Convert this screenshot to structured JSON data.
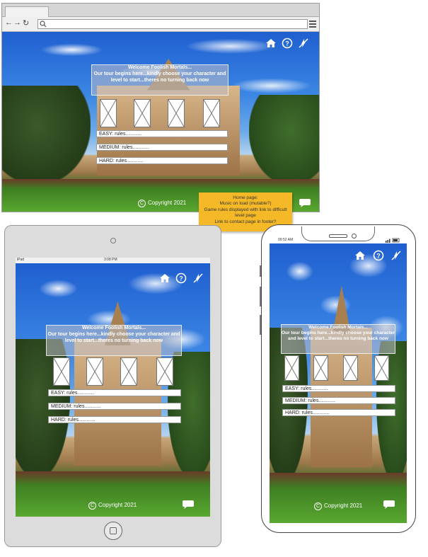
{
  "welcome": {
    "line1": "Welcome Foolish Mortals...",
    "line2": "Our tour begins here...kindly choose your character and level to start...theres no turning back now"
  },
  "rules": {
    "easy": "EASY: rules............",
    "medium": "MEDIUM: rules............",
    "hard": "HARD: rules............"
  },
  "footer": {
    "copyright": "Copyright 2021"
  },
  "note": {
    "lines": [
      "Home page:",
      "Music on load (mutable?)",
      "Game rules displayed with link to difficult level page",
      "Link to contact page in footer?"
    ]
  },
  "tablet": {
    "status_left": "iPad",
    "status_time": "3:08 PM"
  },
  "phone": {
    "status_time": "09:52 AM"
  },
  "icons": [
    "home-icon",
    "help-icon",
    "mute-icon",
    "chat-icon"
  ],
  "colors": {
    "note": "#f5b928",
    "sky": "#3b86e4"
  }
}
